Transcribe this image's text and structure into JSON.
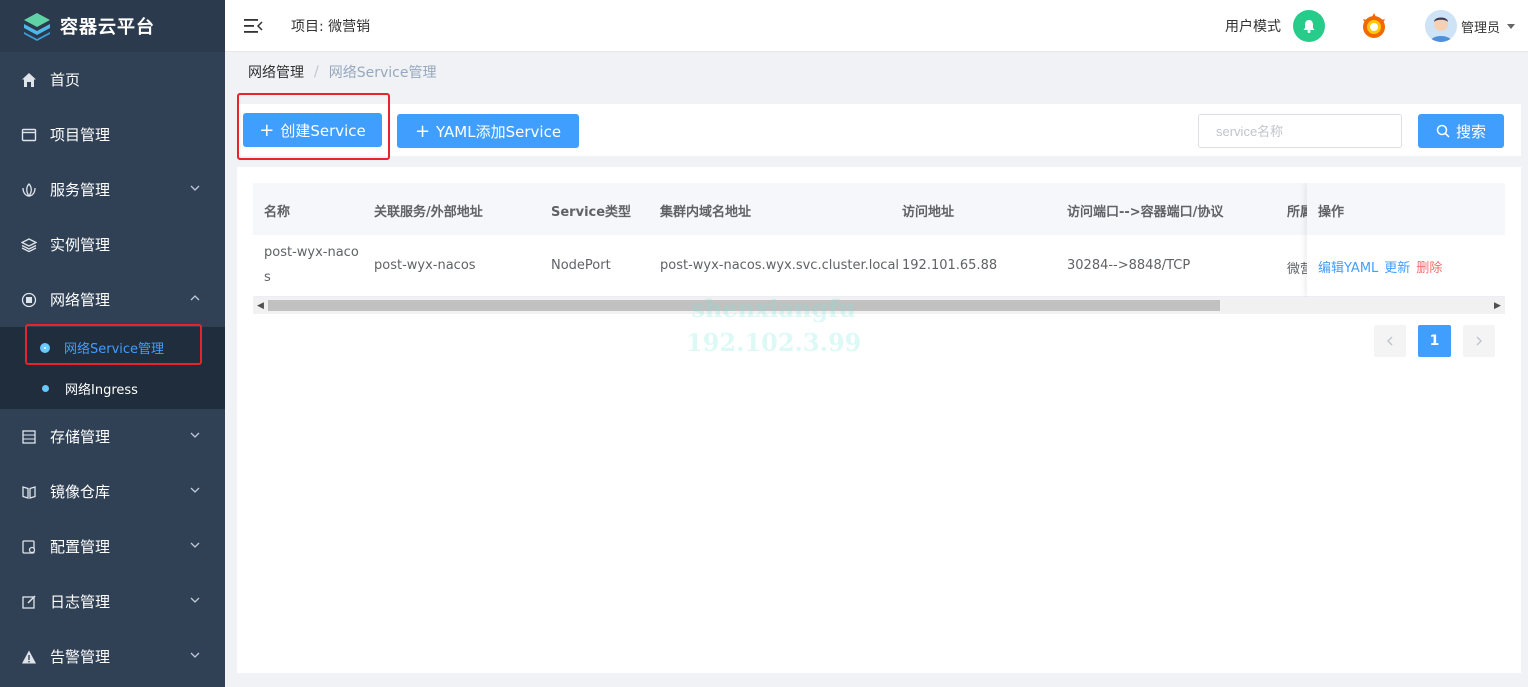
{
  "app": {
    "title": "容器云平台"
  },
  "sidebar": {
    "items": [
      {
        "label": "首页",
        "icon": "home-icon"
      },
      {
        "label": "项目管理",
        "icon": "project-icon"
      },
      {
        "label": "服务管理",
        "icon": "service-icon"
      },
      {
        "label": "实例管理",
        "icon": "layers-icon"
      },
      {
        "label": "网络管理",
        "icon": "network-icon"
      },
      {
        "label": "存储管理",
        "icon": "storage-icon"
      },
      {
        "label": "镜像仓库",
        "icon": "image-repo-icon"
      },
      {
        "label": "配置管理",
        "icon": "config-icon"
      },
      {
        "label": "日志管理",
        "icon": "log-icon"
      },
      {
        "label": "告警管理",
        "icon": "alert-icon"
      }
    ],
    "network_submenu": [
      {
        "label": "网络Service管理",
        "active": true
      },
      {
        "label": "网络Ingress",
        "active": false
      }
    ]
  },
  "header": {
    "project_label": "项目: 微营销",
    "user_mode": "用户模式",
    "admin_name": "管理员"
  },
  "breadcrumb": {
    "first": "网络管理",
    "separator": "/",
    "current": "网络Service管理"
  },
  "toolbar": {
    "create_button": "创建Service",
    "yaml_button": "YAML添加Service",
    "search_placeholder": "service名称",
    "search_button": "搜索"
  },
  "table": {
    "columns": [
      "名称",
      "关联服务/外部地址",
      "Service类型",
      "集群内域名地址",
      "访问地址",
      "访问端口-->容器端口/协议",
      "所属",
      "操作"
    ],
    "rows": [
      {
        "name_line1": "post-wyx-naco",
        "name_line2": "s",
        "service": "post-wyx-nacos",
        "type": "NodePort",
        "cluster_dns": "post-wyx-nacos.wyx.svc.cluster.local",
        "access_address": "192.101.65.88",
        "port_mapping": "30284-->8848/TCP",
        "owner_partial": "微营",
        "actions": {
          "edit": "编辑YAML",
          "update": "更新",
          "delete": "删除"
        }
      }
    ]
  },
  "pagination": {
    "current_page": "1"
  },
  "watermark": {
    "line1": "shenxiangfu",
    "line2": "192.102.3.99"
  },
  "colors": {
    "primary": "#409eff",
    "sidebar": "#304156",
    "danger": "#f56c6c",
    "bell": "#27cc8a"
  }
}
